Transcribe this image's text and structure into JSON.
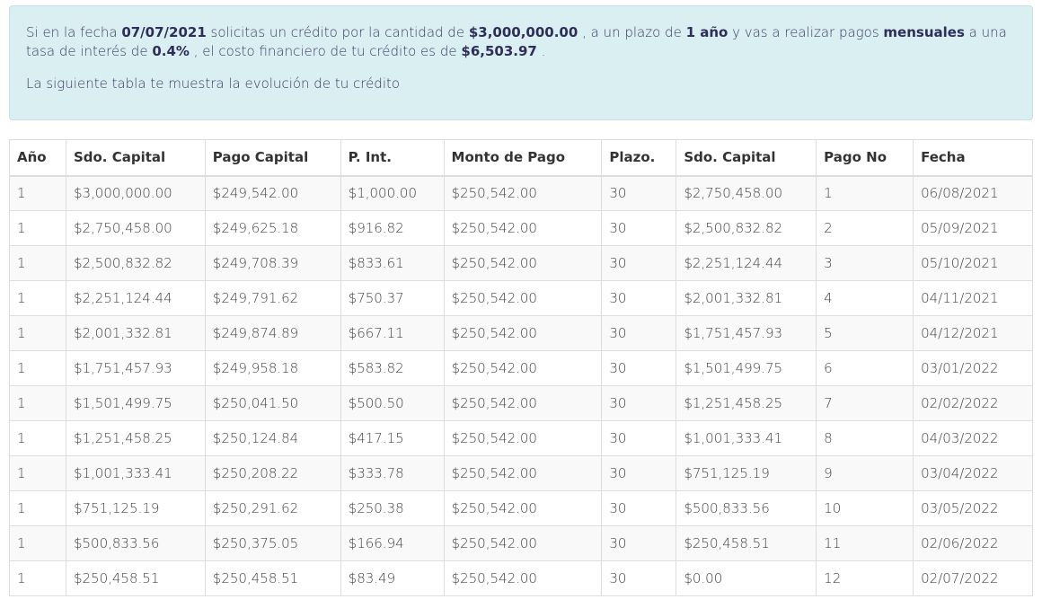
{
  "summary": {
    "t1": "Si en la fecha ",
    "fecha": "07/07/2021",
    "t2": " solicitas un crédito por la cantidad de ",
    "monto": "$3,000,000.00",
    "t3": " , a un plazo de ",
    "plazo": "1 año",
    "t4": " y vas a realizar pagos ",
    "frecuencia": "mensuales",
    "t5": " a una tasa de interés de ",
    "tasa": "0.4%",
    "t6": " , el costo financiero de tu crédito es de ",
    "costo": "$6,503.97",
    "t7": " .",
    "subtitle": "La siguiente tabla te muestra la evolución de tu crédito"
  },
  "table": {
    "headers": [
      "Año",
      "Sdo. Capital",
      "Pago Capital",
      "P. Int.",
      "Monto de Pago",
      "Plazo.",
      "Sdo. Capital",
      "Pago No",
      "Fecha"
    ],
    "rows": [
      [
        "1",
        "$3,000,000.00",
        "$249,542.00",
        "$1,000.00",
        "$250,542.00",
        "30",
        "$2,750,458.00",
        "1",
        "06/08/2021"
      ],
      [
        "1",
        "$2,750,458.00",
        "$249,625.18",
        "$916.82",
        "$250,542.00",
        "30",
        "$2,500,832.82",
        "2",
        "05/09/2021"
      ],
      [
        "1",
        "$2,500,832.82",
        "$249,708.39",
        "$833.61",
        "$250,542.00",
        "30",
        "$2,251,124.44",
        "3",
        "05/10/2021"
      ],
      [
        "1",
        "$2,251,124.44",
        "$249,791.62",
        "$750.37",
        "$250,542.00",
        "30",
        "$2,001,332.81",
        "4",
        "04/11/2021"
      ],
      [
        "1",
        "$2,001,332.81",
        "$249,874.89",
        "$667.11",
        "$250,542.00",
        "30",
        "$1,751,457.93",
        "5",
        "04/12/2021"
      ],
      [
        "1",
        "$1,751,457.93",
        "$249,958.18",
        "$583.82",
        "$250,542.00",
        "30",
        "$1,501,499.75",
        "6",
        "03/01/2022"
      ],
      [
        "1",
        "$1,501,499.75",
        "$250,041.50",
        "$500.50",
        "$250,542.00",
        "30",
        "$1,251,458.25",
        "7",
        "02/02/2022"
      ],
      [
        "1",
        "$1,251,458.25",
        "$250,124.84",
        "$417.15",
        "$250,542.00",
        "30",
        "$1,001,333.41",
        "8",
        "04/03/2022"
      ],
      [
        "1",
        "$1,001,333.41",
        "$250,208.22",
        "$333.78",
        "$250,542.00",
        "30",
        "$751,125.19",
        "9",
        "03/04/2022"
      ],
      [
        "1",
        "$751,125.19",
        "$250,291.62",
        "$250.38",
        "$250,542.00",
        "30",
        "$500,833.56",
        "10",
        "03/05/2022"
      ],
      [
        "1",
        "$500,833.56",
        "$250,375.05",
        "$166.94",
        "$250,542.00",
        "30",
        "$250,458.51",
        "11",
        "02/06/2022"
      ],
      [
        "1",
        "$250,458.51",
        "$250,458.51",
        "$83.49",
        "$250,542.00",
        "30",
        "$0.00",
        "12",
        "02/07/2022"
      ]
    ]
  }
}
